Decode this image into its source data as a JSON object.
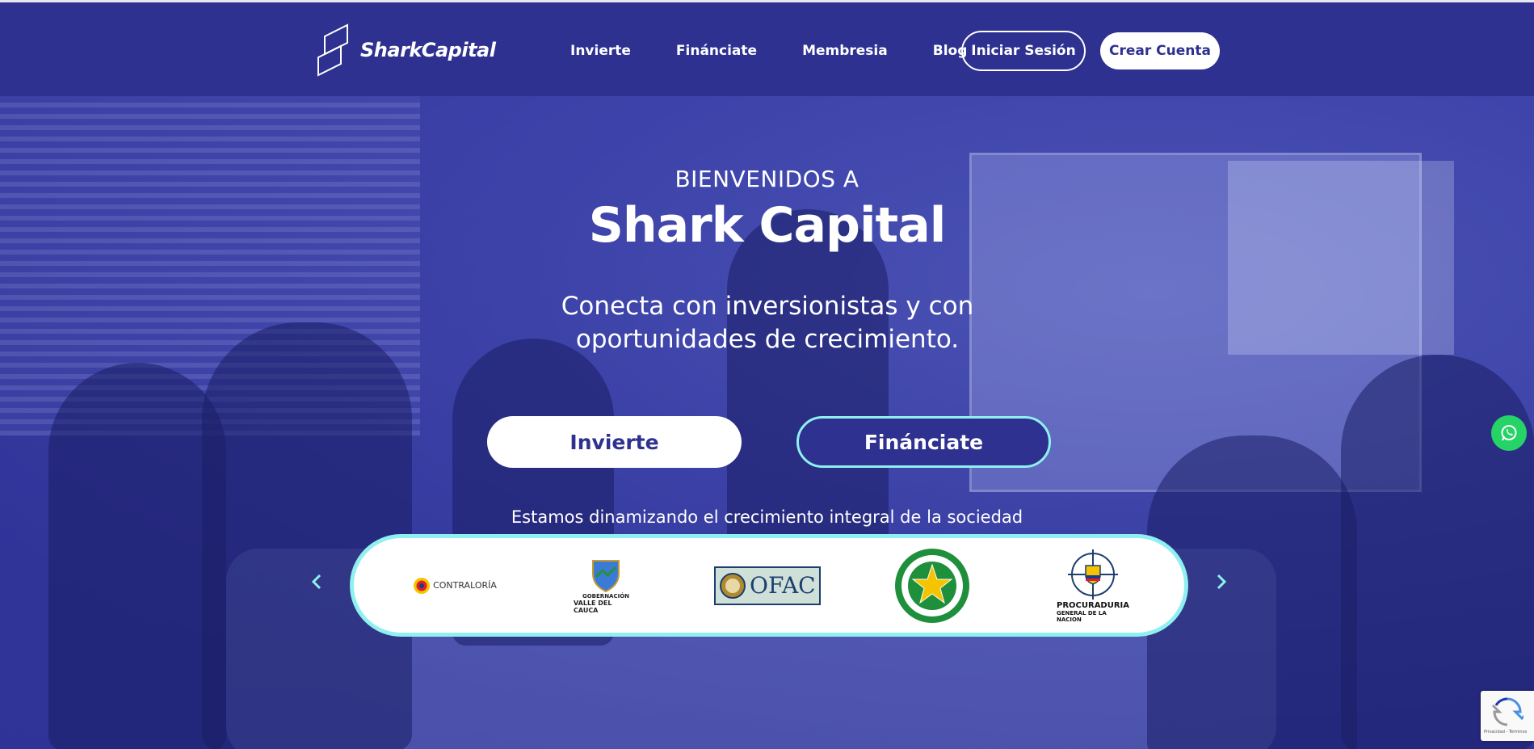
{
  "header": {
    "brand": "SharkCapital",
    "nav": [
      "Invierte",
      "Finánciate",
      "Membresia",
      "Blog"
    ],
    "login_label": "Iniciar Sesión",
    "signup_label": "Crear Cuenta"
  },
  "hero": {
    "welcome": "BIENVENIDOS A",
    "title": "Shark Capital",
    "subtitle": "Conecta con inversionistas y con oportunidades de crecimiento.",
    "invest_label": "Invierte",
    "finance_label": "Finánciate",
    "tagline": "Estamos dinamizando el crecimiento integral de la sociedad",
    "socials": [
      "linkedin-icon",
      "whatsapp-icon",
      "instagram-icon"
    ]
  },
  "partners": {
    "contraloria": "CONTRALORÍA",
    "gobernacion_line1": "GOBERNACIÓN",
    "gobernacion_line2": "VALLE DEL CAUCA",
    "ofac": "OFAC",
    "policia": "POLICÍA NACIONAL",
    "procuraduria_line1": "PROCURADURIA",
    "procuraduria_line2": "GENERAL DE LA NACION"
  },
  "recaptcha": "Privacidad - Términos",
  "colors": {
    "primary": "#2e318f",
    "accent": "#8ff0f0",
    "whatsapp": "#25d366"
  }
}
